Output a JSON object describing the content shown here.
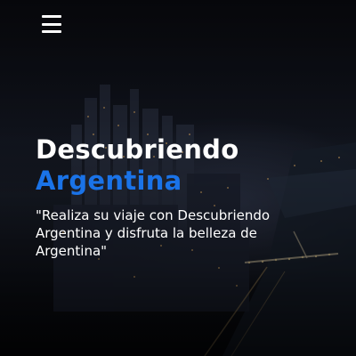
{
  "header": {
    "menu_icon": "hamburger-menu-icon"
  },
  "hero": {
    "title_line1": "Descubriendo",
    "title_line2": "Argentina",
    "subtitle": "\"Realiza su viaje con Descubriendo Argentina y disfruta la belleza de Argentina\""
  },
  "colors": {
    "title_white": "#ffffff",
    "title_accent": "#1a73e8",
    "subtitle": "#ffffff",
    "menu_icon": "#ffffff"
  }
}
